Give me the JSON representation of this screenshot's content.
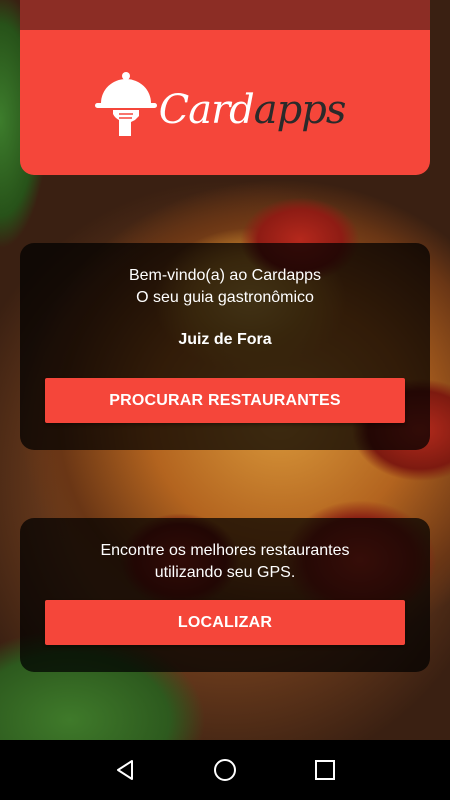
{
  "header": {
    "logo_text_part1": "Card",
    "logo_text_part2": "apps"
  },
  "welcome_panel": {
    "line1": "Bem-vindo(a) ao Cardapps",
    "line2": "O seu guia gastronômico",
    "city": "Juiz de Fora",
    "button_label": "PROCURAR RESTAURANTES"
  },
  "gps_panel": {
    "line1": "Encontre os melhores restaurantes",
    "line2": "utilizando seu GPS.",
    "button_label": "LOCALIZAR"
  },
  "navbar": {
    "items": [
      "back-icon",
      "home-icon",
      "recents-icon"
    ]
  },
  "colors": {
    "accent": "#f5463a",
    "status_strip": "#8c2d25",
    "panel_overlay": "rgba(0,0,0,0.72)",
    "navbar": "#000000"
  }
}
